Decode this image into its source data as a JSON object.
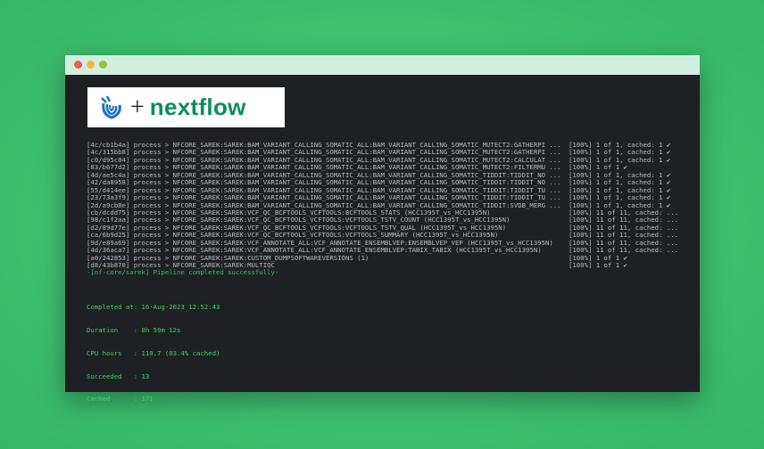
{
  "brand": {
    "plus": "+",
    "name": "nextflow",
    "icon": "nf-core-swirl-icon"
  },
  "log_lines": [
    {
      "hash": "[4c/cb1b4a]",
      "text": "process > NFCORE_SAREK:SAREK:BAM_VARIANT_CALLING_SOMATIC_ALL:BAM_VARIANT_CALLING_SOMATIC_MUTECT2:GATHERPI ...",
      "status": "[100%] 1 of 1, cached: 1 ✔"
    },
    {
      "hash": "[4c/315bb8]",
      "text": "process > NFCORE_SAREK:SAREK:BAM_VARIANT_CALLING_SOMATIC_ALL:BAM_VARIANT_CALLING_SOMATIC_MUTECT2:GATHERPI ...",
      "status": "[100%] 1 of 1, cached: 1 ✔"
    },
    {
      "hash": "[c0/d95c04]",
      "text": "process > NFCORE_SAREK:SAREK:BAM_VARIANT_CALLING_SOMATIC_ALL:BAM_VARIANT_CALLING_SOMATIC_MUTECT2:CALCULAT ...",
      "status": "[100%] 1 of 1, cached: 1 ✔"
    },
    {
      "hash": "[83/b677d2]",
      "text": "process > NFCORE_SAREK:SAREK:BAM_VARIANT_CALLING_SOMATIC_ALL:BAM_VARIANT_CALLING_SOMATIC_MUTECT2:FILTERMU ...",
      "status": "[100%] 1 of 1 ✔"
    },
    {
      "hash": "[4d/ae5c4a]",
      "text": "process > NFCORE_SAREK:SAREK:BAM_VARIANT_CALLING_SOMATIC_ALL:BAM_VARIANT_CALLING_SOMATIC_TIDDIT:TIDDIT_NO ...",
      "status": "[100%] 1 of 1, cached: 1 ✔"
    },
    {
      "hash": "[42/da8958]",
      "text": "process > NFCORE_SAREK:SAREK:BAM_VARIANT_CALLING_SOMATIC_ALL:BAM_VARIANT_CALLING_SOMATIC_TIDDIT:TIDDIT_NO ...",
      "status": "[100%] 1 of 1, cached: 1 ✔"
    },
    {
      "hash": "[55/d414ee]",
      "text": "process > NFCORE_SAREK:SAREK:BAM_VARIANT_CALLING_SOMATIC_ALL:BAM_VARIANT_CALLING_SOMATIC_TIDDIT:TIDDIT_TU ...",
      "status": "[100%] 1 of 1, cached: 1 ✔"
    },
    {
      "hash": "[23/73a3f9]",
      "text": "process > NFCORE_SAREK:SAREK:BAM_VARIANT_CALLING_SOMATIC_ALL:BAM_VARIANT_CALLING_SOMATIC_TIDDIT:TIDDIT_TU ...",
      "status": "[100%] 1 of 1, cached: 1 ✔"
    },
    {
      "hash": "[2d/a9cb8e]",
      "text": "process > NFCORE_SAREK:SAREK:BAM_VARIANT_CALLING_SOMATIC_ALL:BAM_VARIANT_CALLING_SOMATIC_TIDDIT:SVDB_MERG ...",
      "status": "[100%] 1 of 1, cached: 1 ✔"
    },
    {
      "hash": "[cb/dcdd75]",
      "text": "process > NFCORE_SAREK:SAREK:VCF_QC_BCFTOOLS_VCFTOOLS:BCFTOOLS_STATS (HCC1395T_vs_HCC1395N)",
      "status": "[100%] 11 of 11, cached: ..."
    },
    {
      "hash": "[98/c1f2aa]",
      "text": "process > NFCORE_SAREK:SAREK:VCF_QC_BCFTOOLS_VCFTOOLS:VCFTOOLS_TSTV_COUNT (HCC1395T_vs_HCC1395N)",
      "status": "[100%] 11 of 11, cached: ..."
    },
    {
      "hash": "[d2/89d77e]",
      "text": "process > NFCORE_SAREK:SAREK:VCF_QC_BCFTOOLS_VCFTOOLS:VCFTOOLS_TSTV_QUAL (HCC1395T_vs_HCC1395N)",
      "status": "[100%] 11 of 11, cached: ..."
    },
    {
      "hash": "[ca/6b9d25]",
      "text": "process > NFCORE_SAREK:SAREK:VCF_QC_BCFTOOLS_VCFTOOLS:VCFTOOLS_SUMMARY (HCC1395T_vs_HCC1395N)",
      "status": "[100%] 11 of 11, cached: ..."
    },
    {
      "hash": "[9d/e89a69]",
      "text": "process > NFCORE_SAREK:SAREK:VCF_ANNOTATE_ALL:VCF_ANNOTATE_ENSEMBLVEP:ENSEMBLVEP_VEP (HCC1395T_vs_HCC1395N)",
      "status": "[100%] 11 of 11, cached: ..."
    },
    {
      "hash": "[4d/36aca7]",
      "text": "process > NFCORE_SAREK:SAREK:VCF_ANNOTATE_ALL:VCF_ANNOTATE_ENSEMBLVEP:TABIX_TABIX (HCC1395T_vs_HCC1395N)",
      "status": "[100%] 11 of 11, cached: ..."
    },
    {
      "hash": "[a0/242853]",
      "text": "process > NFCORE_SAREK:SAREK:CUSTOM_DUMPSOFTWAREVERSIONS (1)",
      "status": "[100%] 1 of 1 ✔"
    },
    {
      "hash": "[d8/43b870]",
      "text": "process > NFCORE_SAREK:SAREK:MULTIQC",
      "status": "[100%] 1 of 1 ✔"
    }
  ],
  "completion_message": "-[nf-core/sarek] Pipeline completed successfully-",
  "summary": {
    "completed_at": "Completed at: 16-Aug-2023 12:52:43",
    "duration": "Duration    : 8h 59m 12s",
    "cpu_hours": "CPU hours   : 110.7 (83.4% cached)",
    "succeeded": "Succeeded   : 13",
    "cached": "Cached      : 171"
  },
  "colors": {
    "background": "#3fc170",
    "terminal": "#1e2023",
    "titlebar": "#d3eee0",
    "success_text": "#3fd35f",
    "log_text": "#b7bdc2",
    "brand_green": "#0b8d62"
  }
}
